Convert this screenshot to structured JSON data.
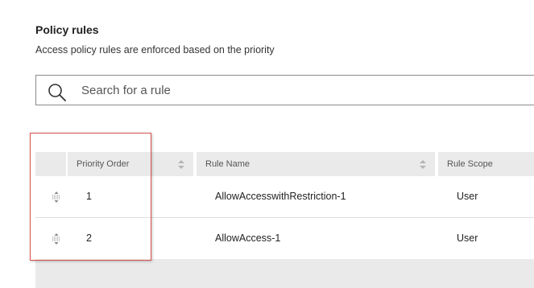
{
  "section": {
    "title": "Policy rules",
    "description": "Access policy rules are enforced based on the priority"
  },
  "search": {
    "placeholder": "Search for a rule",
    "value": ""
  },
  "table": {
    "columns": [
      {
        "label": "Priority Order",
        "sortable": true
      },
      {
        "label": "Rule Name",
        "sortable": true
      },
      {
        "label": "Rule Scope",
        "sortable": false
      }
    ],
    "rows": [
      {
        "priority": "1",
        "name": "AllowAccesswithRestriction-1",
        "scope": "User"
      },
      {
        "priority": "2",
        "name": "AllowAccess-1",
        "scope": "User"
      }
    ]
  },
  "icons": {
    "search": "search-icon",
    "sort": "sort-icon",
    "drag": "drag-handle-icon"
  },
  "colors": {
    "header_bg": "#eaeaea",
    "highlight": "#d9534f",
    "border": "#8a8a8a"
  }
}
